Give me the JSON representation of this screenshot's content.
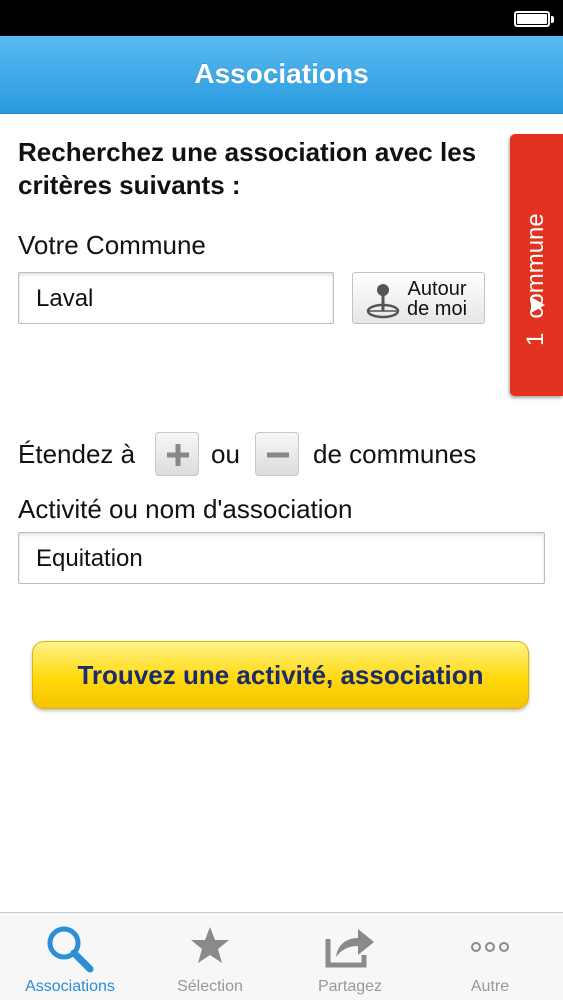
{
  "app": {
    "title": "Associations"
  },
  "form": {
    "intro": "Recherchez une association avec les critères suivants :",
    "commune_label": "Votre Commune",
    "commune_value": "Laval",
    "autour_line1": "Autour",
    "autour_line2": "de moi",
    "extend_prefix": "Étendez à",
    "extend_middle": "ou",
    "extend_suffix": "de communes",
    "activite_label": "Activité ou nom d'association",
    "activite_value": "Equitation",
    "submit_label": "Trouvez une activité, association"
  },
  "side_tab": {
    "count": "1",
    "label": "commune",
    "color": "#e3321f"
  },
  "tabbar": {
    "items": [
      {
        "label": "Associations",
        "icon": "search-icon",
        "active": true
      },
      {
        "label": "Sélection",
        "icon": "star-icon",
        "active": false
      },
      {
        "label": "Partagez",
        "icon": "share-icon",
        "active": false
      },
      {
        "label": "Autre",
        "icon": "more-icon",
        "active": false
      }
    ],
    "active_color": "#2a8fd6"
  },
  "colors": {
    "navbar": "#2a9be0",
    "button": "#ffd90c",
    "button_text": "#1d2b6a"
  }
}
